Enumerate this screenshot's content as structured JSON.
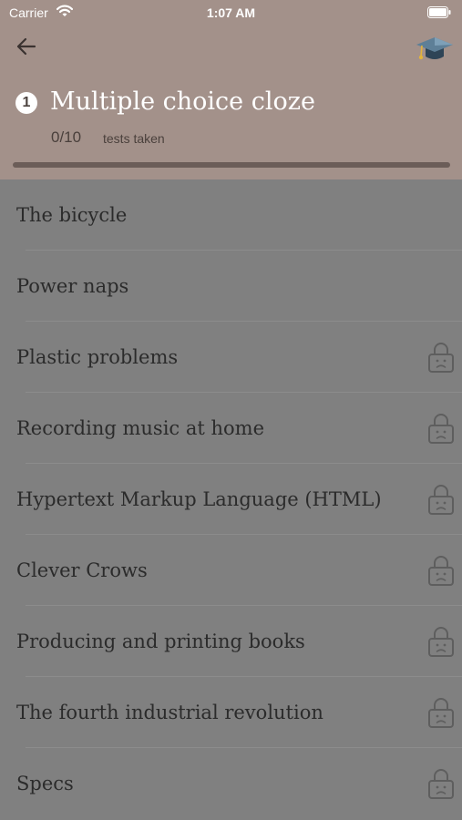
{
  "status_bar": {
    "carrier": "Carrier",
    "time": "1:07 AM"
  },
  "header": {
    "level_badge": "1",
    "title": "Multiple choice cloze",
    "progress_count": "0/10",
    "progress_label": "tests taken",
    "progress_fraction": 0
  },
  "icons": {
    "back": "arrow-left-icon",
    "cap": "graduation-cap-icon",
    "lock": "lock-sad-face-icon"
  },
  "colors": {
    "header_bg": "#a3918a",
    "list_bg": "#808080",
    "title_text": "#ffffff"
  },
  "items": [
    {
      "label": "The bicycle",
      "locked": false
    },
    {
      "label": "Power naps",
      "locked": false
    },
    {
      "label": "Plastic problems",
      "locked": true
    },
    {
      "label": "Recording music at home",
      "locked": true
    },
    {
      "label": "Hypertext Markup Language (HTML)",
      "locked": true
    },
    {
      "label": "Clever Crows",
      "locked": true
    },
    {
      "label": "Producing and printing books",
      "locked": true
    },
    {
      "label": "The fourth industrial revolution",
      "locked": true
    },
    {
      "label": "Specs",
      "locked": true
    }
  ]
}
